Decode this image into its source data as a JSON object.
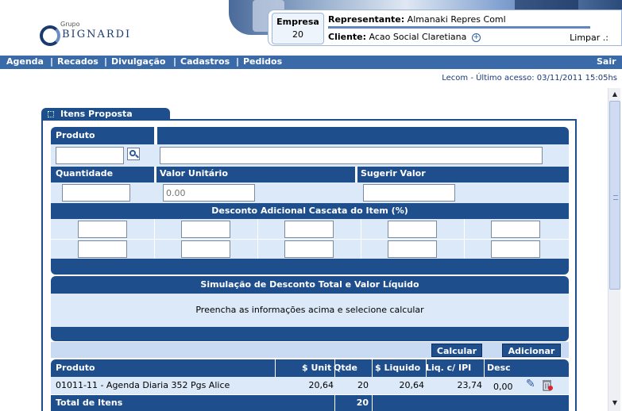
{
  "header": {
    "logo_small": "Grupo",
    "logo_name": "BIGNARDI",
    "empresa_label": "Empresa",
    "empresa_value": "20",
    "representante_label": "Representante:",
    "representante_value": "Almanaki Repres Coml",
    "cliente_label": "Cliente:",
    "cliente_value": "Acao Social Claretiana",
    "limpar": "Limpar .:"
  },
  "nav": {
    "items": [
      "Agenda",
      "|",
      "Recados",
      "|",
      "Divulgação",
      "|",
      "Cadastros",
      "|",
      "Pedidos"
    ],
    "sair": "Sair"
  },
  "status": "Lecom - Último acesso: 03/11/2011 15:05hs",
  "panel": {
    "tab_title": "Itens Proposta",
    "produto_label": "Produto",
    "quantidade_label": "Quantidade",
    "valor_unitario_label": "Valor Unitário",
    "valor_unitario_placeholder": "0.00",
    "sugerir_valor_label": "Sugerir Valor",
    "desconto_title": "Desconto Adicional Cascata do Item (%)",
    "simulacao_title": "Simulação de Desconto Total e Valor Líquido",
    "simulacao_msg": "Preencha as informações acima e selecione calcular",
    "calcular": "Calcular",
    "adicionar": "Adicionar"
  },
  "table": {
    "headers": [
      "Produto",
      "$ Unit",
      "Qtde",
      "$ Liquido",
      "Liq. c/ IPI",
      "Desc"
    ],
    "rows": [
      {
        "produto": "01011-11 - Agenda Diaria 352 Pgs Alice",
        "unit": "20,64",
        "qtde": "20",
        "liquido": "20,64",
        "liq_ipi": "23,74",
        "desc": "0,00"
      }
    ],
    "total_label": "Total de Itens",
    "total_value": "20"
  },
  "colors": {
    "primary": "#1e4e8c",
    "light": "#dce9f8",
    "nav": "#3a6aa8"
  },
  "icons": [
    "magnify-icon",
    "plus-circle-icon",
    "edit-icon",
    "delete-icon",
    "scroll-up-icon",
    "scroll-down-icon"
  ]
}
